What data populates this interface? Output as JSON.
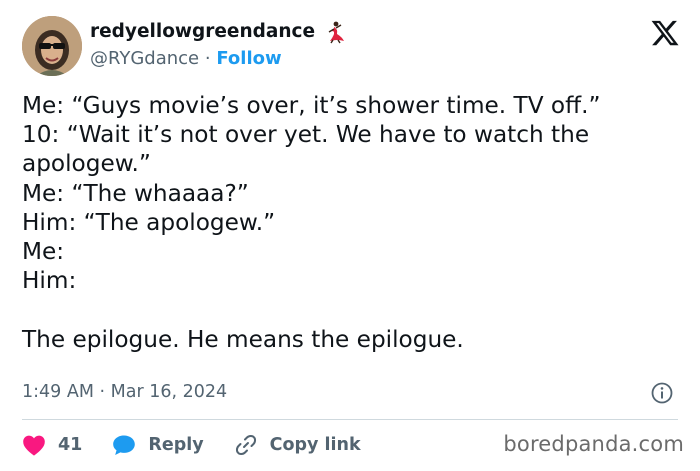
{
  "author": {
    "display_name": "redyellowgreendance",
    "handle": "@RYGdance",
    "separator": "·",
    "follow_label": "Follow",
    "badge_icon": "dancer-emoji-icon"
  },
  "tweet": {
    "lines": [
      "Me: “Guys movie’s over, it’s shower time. TV off.”",
      "10: “Wait it’s not over yet. We have to watch the",
      "apologew.”",
      "Me: “The whaaaa?”",
      "Him: “The apologew.”",
      "Me:",
      "Him:",
      "",
      "The epilogue. He means the epilogue."
    ]
  },
  "meta": {
    "time": "1:49 AM",
    "separator": "·",
    "date": "Mar 16, 2024"
  },
  "actions": {
    "like_count": "41",
    "reply_label": "Reply",
    "copy_label": "Copy link"
  },
  "watermark": "boredpanda.com",
  "colors": {
    "text": "#0f1419",
    "secondary": "#536471",
    "link": "#1d9bf0",
    "like": "#f91880",
    "divider": "#cfd9de"
  }
}
